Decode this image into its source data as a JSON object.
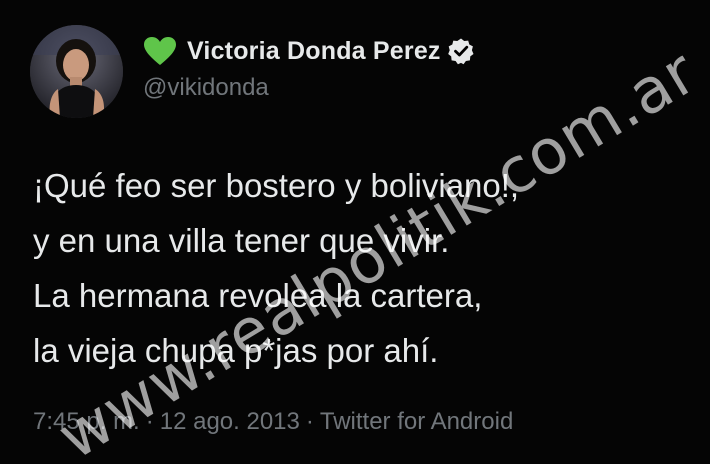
{
  "user": {
    "display_name": "Victoria Donda Perez",
    "handle": "@vikidonda",
    "name_emoji_icon": "green-heart-icon",
    "verified_icon": "verified-badge-icon"
  },
  "tweet": {
    "lines": [
      "¡Qué feo ser bostero y boliviano!,",
      "y en una villa tener que vivir.",
      "La hermana revolea la cartera,",
      "la vieja chupa p*jas por ahí."
    ],
    "time": "7:45 p. m.",
    "date": "12 ago. 2013",
    "source": "Twitter for Android",
    "separator": "·"
  },
  "watermark": "www.realpolitik.com.ar",
  "colors": {
    "background": "#000000",
    "text": "#e7e9ea",
    "secondary": "#71767b",
    "heart": "#5fc54a"
  }
}
